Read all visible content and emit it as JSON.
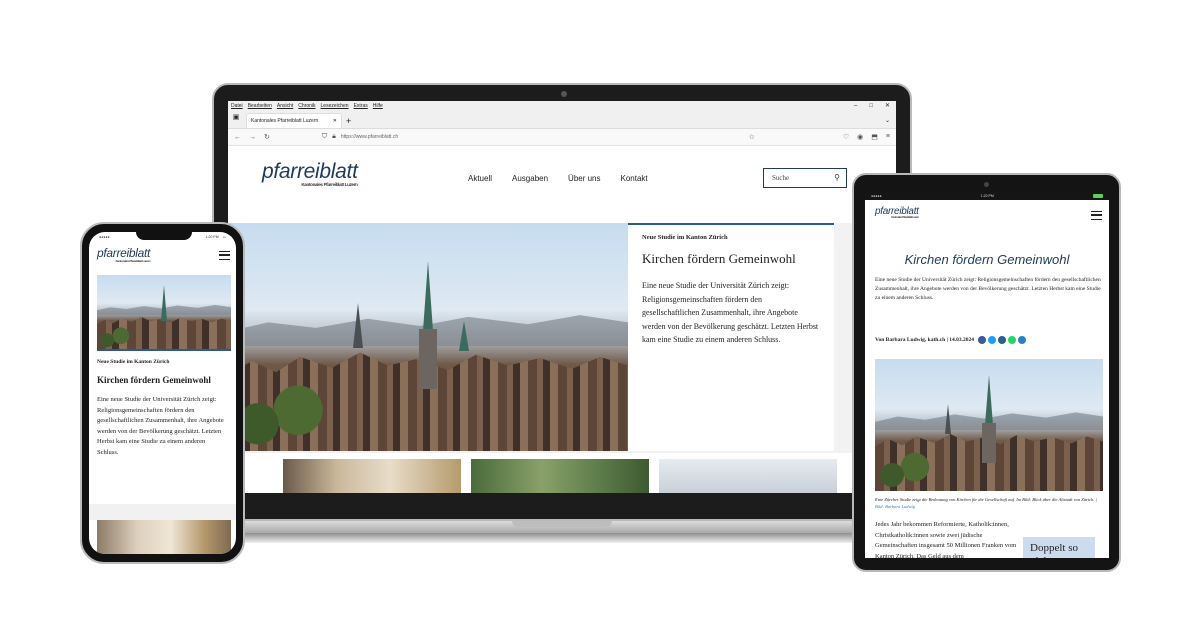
{
  "laptop": {
    "menu": [
      "Datei",
      "Bearbeiten",
      "Ansicht",
      "Chronik",
      "Lesezeichen",
      "Extras",
      "Hilfe"
    ],
    "window_controls": [
      "–",
      "□",
      "✕"
    ],
    "tab_title": "Kantonales Pfarreiblatt Luzern",
    "url": "https://www.pfarreiblatt.ch",
    "logo": "pfarreiblatt",
    "logo_sub": "Kantonales Pfarreiblatt Luzern",
    "nav": [
      "Aktuell",
      "Ausgaben",
      "Über uns",
      "Kontakt"
    ],
    "search_placeholder": "Suche",
    "hero": {
      "kicker": "Neue Studie im Kanton Zürich",
      "title": "Kirchen fördern Gemeinwohl",
      "text": "Eine neue Studie der Universität Zürich zeigt: Religionsgemeinschaften fördern den gesellschaftlichen Zusammenhalt, ihre Angebote werden von der Bevölkerung geschätzt. Letzten Herbst kam eine Studie zu einem anderen Schluss."
    }
  },
  "phone": {
    "status_left": "●●●●●",
    "status_time": "1:20 PM",
    "logo": "pfarreiblatt",
    "logo_sub": "Kantonales Pfarreiblatt Luzern",
    "kicker": "Neue Studie im Kanton Zürich",
    "title": "Kirchen fördern Gemeinwohl",
    "text": "Eine neue Studie der Universität Zürich zeigt: Religionsgemeinschaften fördern den gesellschaftlichen Zusammenhalt, ihre Angebote werden von der Bevölkerung geschätzt. Letzten Herbst kam eine Studie zu einem anderen Schluss."
  },
  "tablet": {
    "status_left": "●●●●●",
    "status_time": "1:20 PM",
    "logo": "pfarreiblatt",
    "logo_sub": "Kantonales Pfarreiblatt Luzern",
    "title": "Kirchen fördern Gemeinwohl",
    "lead": "Eine neue Studie der Universität Zürich zeigt: Religionsgemeinschaften fördern den gesellschaftlichen Zusammenhalt, ihre Angebote werden von der Bevölkerung geschätzt. Letzten Herbst kam eine Studie zu einem anderen Schluss.",
    "byline": "Von Barbara Ludwig, kath.ch | 14.03.2024",
    "share_colors": [
      "#3b5998",
      "#1da1f2",
      "#2c5f8a",
      "#25d366",
      "#2d7fc1"
    ],
    "caption": "Eine Zürcher Studie zeigt die Bedeutung von Kirchen für die Gesellschaft auf. Im Bild: Blick über die Altstadt von Zürich. |",
    "caption_credit": "Bild: Barbara Ludwig",
    "body": "Jedes Jahr bekommen Reformierte, Katholik:innen, Christkatholik:innen sowie zwei jüdische Gemeinschaften insgesamt 50 Millionen Franken vom Kanton Zürich. Das Geld aus dem",
    "infobox": "Doppelt so viele"
  }
}
